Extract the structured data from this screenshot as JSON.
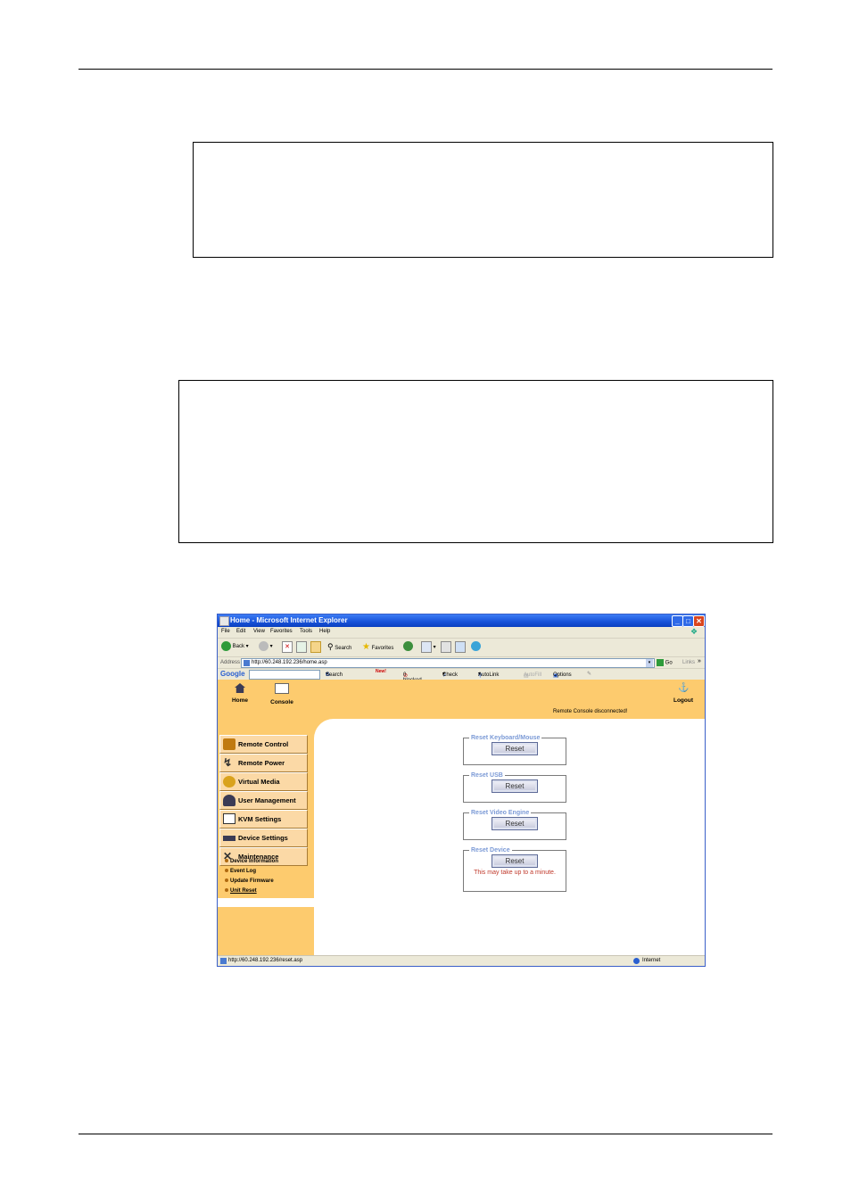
{
  "browser": {
    "title": "Home - Microsoft Internet Explorer",
    "menu": [
      "File",
      "Edit",
      "View",
      "Favorites",
      "Tools",
      "Help"
    ],
    "toolbar": {
      "back": "Back",
      "search": "Search",
      "favorites": "Favorites"
    },
    "address": {
      "label": "Address",
      "url": "http://60.248.192.236/home.asp",
      "go": "Go",
      "links": "Links"
    },
    "google": {
      "brand": "Google",
      "search": "Search",
      "blocked": "0 blocked",
      "check": "Check",
      "autolink": "AutoLink",
      "autofill": "AutoFill",
      "options": "Options",
      "new": "New!"
    },
    "status": {
      "url": "http://60.248.192.236/reset.asp",
      "zone": "Internet"
    }
  },
  "app": {
    "nav": {
      "home": "Home",
      "console": "Console",
      "logout": "Logout",
      "status": "Remote Console disconnected!"
    },
    "sidebar": [
      {
        "label": "Remote Control",
        "icon": "remote-control-icon"
      },
      {
        "label": "Remote Power",
        "icon": "lightning-icon"
      },
      {
        "label": "Virtual Media",
        "icon": "disk-icon"
      },
      {
        "label": "User Management",
        "icon": "users-icon"
      },
      {
        "label": "KVM Settings",
        "icon": "monitor-icon"
      },
      {
        "label": "Device Settings",
        "icon": "device-icon"
      },
      {
        "label": "Maintenance",
        "icon": "tools-icon"
      }
    ],
    "submenu": [
      "Device Information",
      "Event Log",
      "Update Firmware",
      "Unit Reset"
    ],
    "resets": [
      {
        "legend": "Reset Keyboard/Mouse",
        "button": "Reset"
      },
      {
        "legend": "Reset USB",
        "button": "Reset"
      },
      {
        "legend": "Reset Video Engine",
        "button": "Reset"
      },
      {
        "legend": "Reset Device",
        "button": "Reset",
        "note": "This may take up to a minute."
      }
    ]
  },
  "colors": {
    "accent": "#fdcb6e",
    "titlebar": "#1651d8",
    "legend": "#7b9ad6",
    "note": "#c0392b"
  }
}
